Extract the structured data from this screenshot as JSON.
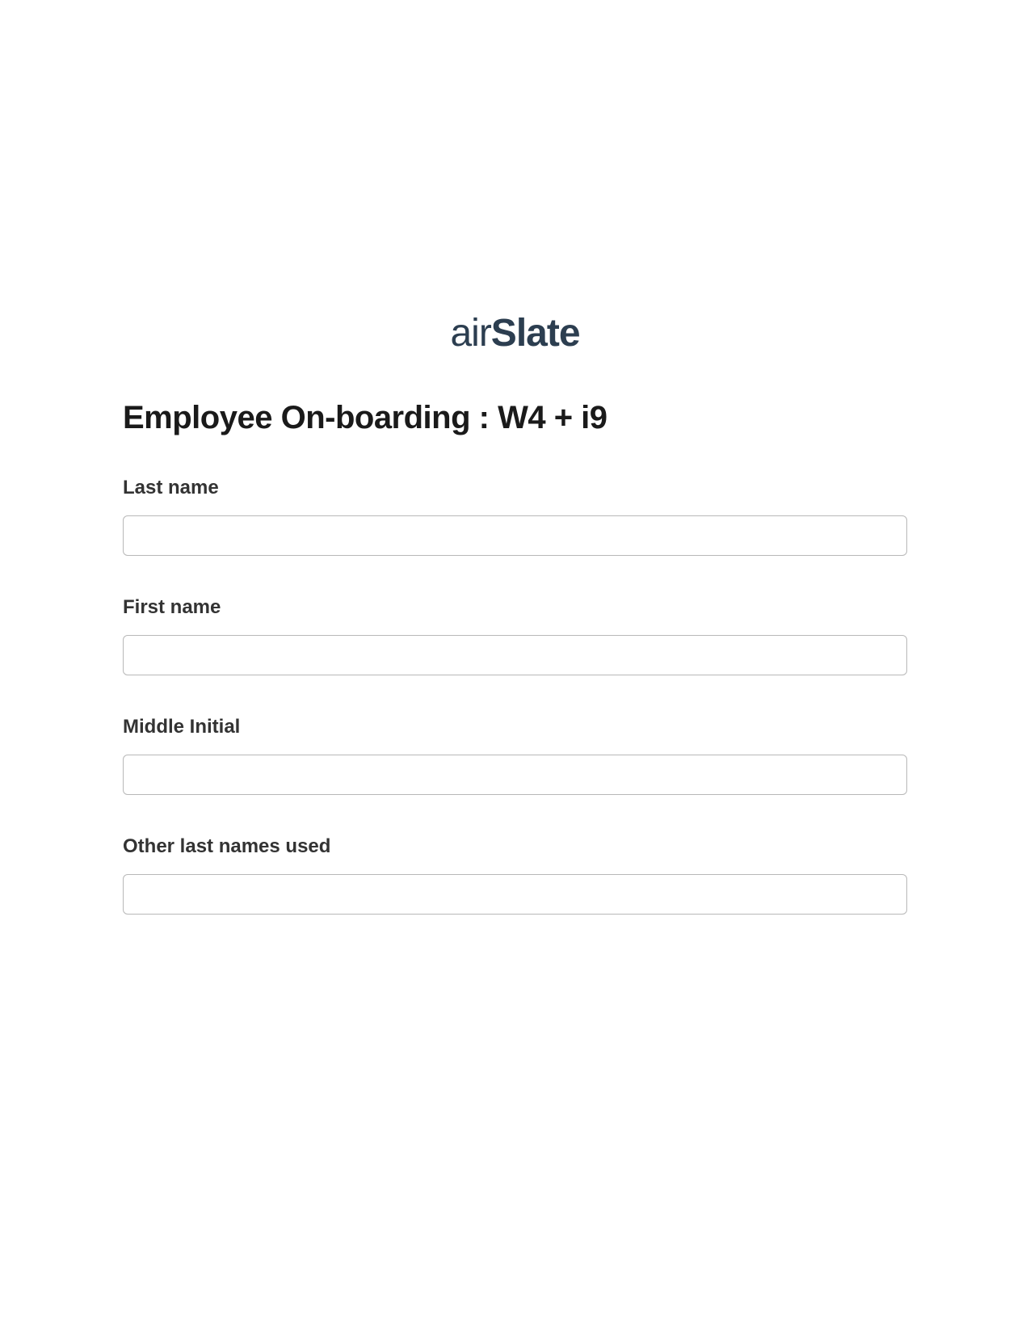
{
  "brand": {
    "name_part1": "air",
    "name_part2": "Slate"
  },
  "form": {
    "title": "Employee On-boarding : W4 + i9",
    "fields": [
      {
        "label": "Last name",
        "value": ""
      },
      {
        "label": "First name",
        "value": ""
      },
      {
        "label": "Middle Initial",
        "value": ""
      },
      {
        "label": "Other last names used",
        "value": ""
      }
    ]
  }
}
